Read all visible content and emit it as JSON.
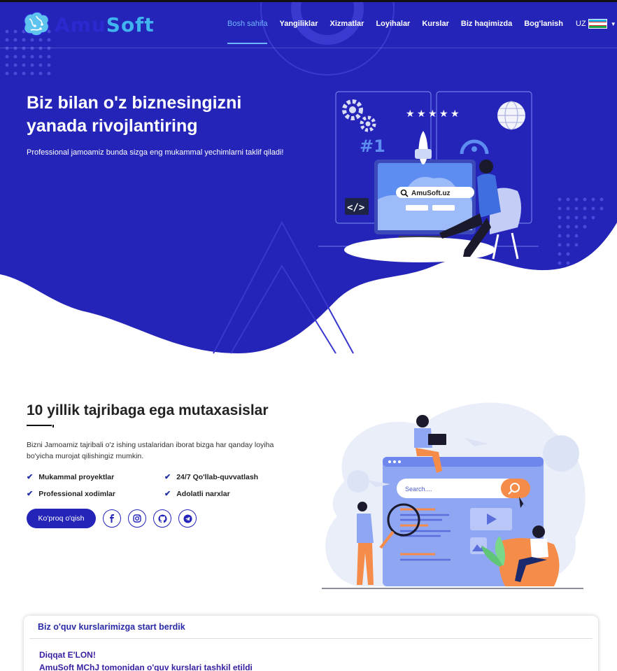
{
  "colors": {
    "hero": "#2424b8",
    "accent": "#6fb6ff",
    "brand_dark": "#2a2ad0",
    "brand_light": "#3fb4ee"
  },
  "logo": {
    "part1": "Amu",
    "part2": "Soft",
    "icon": "brain-circuit-icon"
  },
  "nav": {
    "items": [
      "Bosh sahifa",
      "Yangiliklar",
      "Xizmatlar",
      "Loyihalar",
      "Kurslar",
      "Biz haqimizda",
      "Bog'lanish"
    ],
    "active": "Bosh sahifa",
    "lang": "UZ"
  },
  "hero": {
    "title": "Biz bilan o'z biznesingizni yanada rivojlantiring",
    "subtitle": "Professional jamoamiz bunda sizga eng mukammal yechimlarni taklif qiladi!",
    "illustration": {
      "badge": "#1",
      "search_text": "AmuSoft.uz",
      "code_tag": "</>",
      "stars": 5
    }
  },
  "about": {
    "title": "10 yillik tajribaga ega mutaxasislar",
    "text": "Bizni Jamoamiz tajribali o'z ishing ustalaridan iborat bizga har qanday loyiha bo'yicha murojat qilishingiz mumkin.",
    "features": [
      "Mukammal proyektlar",
      "24/7 Qo'llab-quvvatlash",
      "Professional xodimlar",
      "Adolatli narxlar"
    ],
    "button": "Ko'proq o'qish",
    "socials": [
      "facebook-icon",
      "instagram-icon",
      "github-icon",
      "telegram-icon"
    ],
    "illustration": {
      "search_placeholder": "Search...."
    }
  },
  "news": {
    "title": "Biz o'quv kurslarimizga start berdik",
    "line1": "Diqqat E'LON!",
    "line2": "AmuSoft MChJ tomonidan o'quv kurslari tashkil etildi"
  }
}
